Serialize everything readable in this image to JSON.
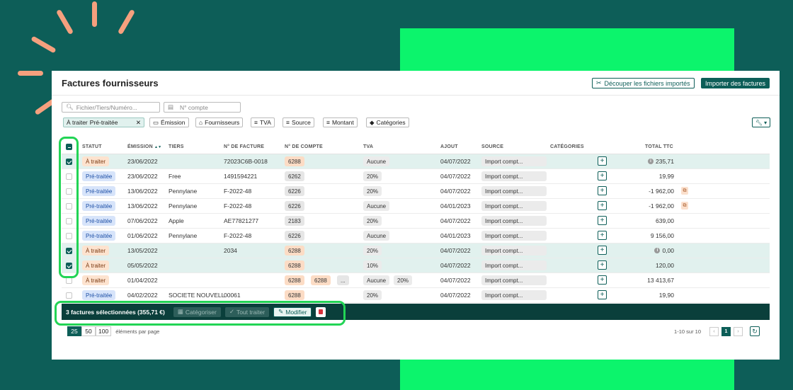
{
  "colors": {
    "background": "#0d5e58",
    "accent_green": "#0cf46c",
    "highlight": "#22d455",
    "rays": "#f5a07e",
    "primary": "#0d5e58"
  },
  "page": {
    "title": "Factures fournisseurs"
  },
  "header_buttons": {
    "split_label": "Découper les fichiers importés",
    "split_icon": "scissors-icon",
    "import_label": "Importer des factures"
  },
  "search": {
    "main_placeholder": "Fichier/Tiers/Numéro...",
    "account_placeholder": "N° compte"
  },
  "filters": {
    "active_chip": {
      "label1": "À traiter",
      "label2": "Pré-traitée"
    },
    "chips": [
      "Émission",
      "Fournisseurs",
      "TVA",
      "Source",
      "Montant",
      "Catégories"
    ]
  },
  "table": {
    "columns": {
      "status": "STATUT",
      "emission": "ÉMISSION",
      "tiers": "TIERS",
      "invoice_no": "N° DE FACTURE",
      "account_no": "N° DE COMPTE",
      "tva": "TVA",
      "added": "AJOUT",
      "source": "SOURCE",
      "categories": "CATÉGORIES",
      "total": "TOTAL TTC"
    },
    "sort_indicator": "▲▼",
    "rows": [
      {
        "checked": true,
        "status": "À traiter",
        "status_type": "todo",
        "date": "23/06/2022",
        "tiers": "",
        "invoice": "72023C6B-0018",
        "accounts": [
          "6288"
        ],
        "account_colors": [
          "orange"
        ],
        "tva": [
          "Aucune"
        ],
        "added": "04/07/2022",
        "source": "Import compt...",
        "total": "235,71",
        "info": true,
        "dup": false
      },
      {
        "checked": false,
        "status": "Pré-traitée",
        "status_type": "pre",
        "date": "23/06/2022",
        "tiers": "Free",
        "invoice": "1491594221",
        "accounts": [
          "6262"
        ],
        "account_colors": [
          "grey"
        ],
        "tva": [
          "20%"
        ],
        "added": "04/07/2022",
        "source": "Import compt...",
        "total": "19,99",
        "info": false,
        "dup": false
      },
      {
        "checked": false,
        "status": "Pré-traitée",
        "status_type": "pre",
        "date": "13/06/2022",
        "tiers": "Pennylane",
        "invoice": "F-2022-48",
        "accounts": [
          "6226"
        ],
        "account_colors": [
          "grey"
        ],
        "tva": [
          "20%"
        ],
        "added": "04/07/2022",
        "source": "Import compt...",
        "total": "-1 962,00",
        "info": false,
        "dup": true
      },
      {
        "checked": false,
        "status": "Pré-traitée",
        "status_type": "pre",
        "date": "13/06/2022",
        "tiers": "Pennylane",
        "invoice": "F-2022-48",
        "accounts": [
          "6226"
        ],
        "account_colors": [
          "grey"
        ],
        "tva": [
          "Aucune"
        ],
        "added": "04/01/2023",
        "source": "Import compt...",
        "total": "-1 962,00",
        "info": false,
        "dup": true
      },
      {
        "checked": false,
        "status": "Pré-traitée",
        "status_type": "pre",
        "date": "07/06/2022",
        "tiers": "Apple",
        "invoice": "AE77821277",
        "accounts": [
          "2183"
        ],
        "account_colors": [
          "grey"
        ],
        "tva": [
          "20%"
        ],
        "added": "04/07/2022",
        "source": "Import compt...",
        "total": "639,00",
        "info": false,
        "dup": false
      },
      {
        "checked": false,
        "status": "Pré-traitée",
        "status_type": "pre",
        "date": "01/06/2022",
        "tiers": "Pennylane",
        "invoice": "F-2022-48",
        "accounts": [
          "6226"
        ],
        "account_colors": [
          "grey"
        ],
        "tva": [
          "Aucune"
        ],
        "added": "04/01/2023",
        "source": "Import compt...",
        "total": "9 156,00",
        "info": false,
        "dup": false
      },
      {
        "checked": true,
        "status": "À traiter",
        "status_type": "todo",
        "date": "13/05/2022",
        "tiers": "",
        "invoice": "2034",
        "accounts": [
          "6288"
        ],
        "account_colors": [
          "orange"
        ],
        "tva": [
          "20%"
        ],
        "added": "04/07/2022",
        "source": "Import compt...",
        "total": "0,00",
        "info": true,
        "dup": false
      },
      {
        "checked": true,
        "status": "À traiter",
        "status_type": "todo",
        "date": "05/05/2022",
        "tiers": "",
        "invoice": "",
        "accounts": [
          "6288"
        ],
        "account_colors": [
          "orange"
        ],
        "tva": [
          "10%"
        ],
        "added": "04/07/2022",
        "source": "Import compt...",
        "total": "120,00",
        "info": false,
        "dup": false
      },
      {
        "checked": false,
        "status": "À traiter",
        "status_type": "todo",
        "date": "01/04/2022",
        "tiers": "",
        "invoice": "",
        "accounts": [
          "6288",
          "6288",
          "..."
        ],
        "account_colors": [
          "orange",
          "orange",
          "grey"
        ],
        "tva": [
          "Aucune",
          "20%"
        ],
        "added": "04/07/2022",
        "source": "Import compt...",
        "total": "13 413,67",
        "info": false,
        "dup": false
      },
      {
        "checked": false,
        "status": "Pré-traitée",
        "status_type": "pre",
        "date": "04/02/2022",
        "tiers": "SOCIETE NOUVELL",
        "invoice": "00061",
        "accounts": [
          "6288"
        ],
        "account_colors": [
          "orange"
        ],
        "tva": [
          "20%"
        ],
        "added": "04/07/2022",
        "source": "Import compt...",
        "total": "19,90",
        "info": false,
        "dup": false
      }
    ]
  },
  "selection_bar": {
    "summary": "3 factures sélectionnées (355,71 €)",
    "categorize": "Catégoriser",
    "process_all": "Tout traiter",
    "edit": "Modifier"
  },
  "pagination": {
    "sizes": [
      "25",
      "50",
      "100"
    ],
    "active_size": "25",
    "per_page_label": "éléments par page",
    "range": "1-10 sur 10",
    "current_page": "1"
  }
}
